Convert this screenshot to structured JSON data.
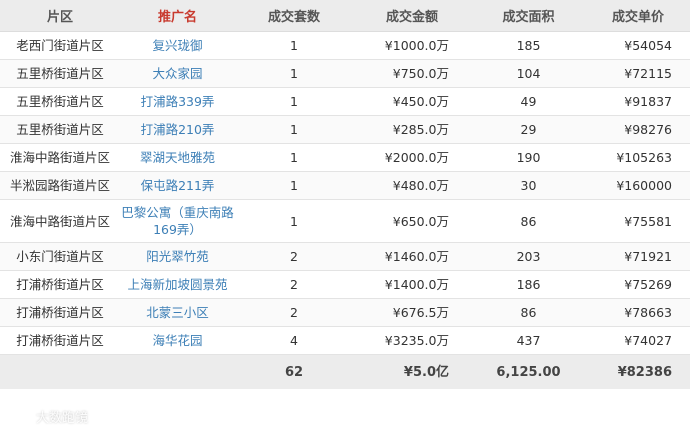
{
  "table": {
    "headers": [
      "片区",
      "推广名",
      "成交套数",
      "成交金额",
      "成交面积",
      "成交单价"
    ],
    "rows": [
      {
        "area": "老西门街道片区",
        "name": "复兴珑御",
        "units": "1",
        "amount": "¥1000.0万",
        "size": "185",
        "price": "¥54054"
      },
      {
        "area": "五里桥街道片区",
        "name": "大众家园",
        "units": "1",
        "amount": "¥750.0万",
        "size": "104",
        "price": "¥72115"
      },
      {
        "area": "五里桥街道片区",
        "name": "打浦路339弄",
        "units": "1",
        "amount": "¥450.0万",
        "size": "49",
        "price": "¥91837"
      },
      {
        "area": "五里桥街道片区",
        "name": "打浦路210弄",
        "units": "1",
        "amount": "¥285.0万",
        "size": "29",
        "price": "¥98276"
      },
      {
        "area": "淮海中路街道片区",
        "name": "翠湖天地雅苑",
        "units": "1",
        "amount": "¥2000.0万",
        "size": "190",
        "price": "¥105263"
      },
      {
        "area": "半淞园路街道片区",
        "name": "保屯路211弄",
        "units": "1",
        "amount": "¥480.0万",
        "size": "30",
        "price": "¥160000"
      },
      {
        "area": "淮海中路街道片区",
        "name": "巴黎公寓（重庆南路169弄）",
        "units": "1",
        "amount": "¥650.0万",
        "size": "86",
        "price": "¥75581"
      },
      {
        "area": "小东门街道片区",
        "name": "阳光翠竹苑",
        "units": "2",
        "amount": "¥1460.0万",
        "size": "203",
        "price": "¥71921"
      },
      {
        "area": "打浦桥街道片区",
        "name": "上海新加坡圆景苑",
        "units": "2",
        "amount": "¥1400.0万",
        "size": "186",
        "price": "¥75269"
      },
      {
        "area": "打浦桥街道片区",
        "name": "北蒙三小区",
        "units": "2",
        "amount": "¥676.5万",
        "size": "86",
        "price": "¥78663"
      },
      {
        "area": "打浦桥街道片区",
        "name": "海华花园",
        "units": "4",
        "amount": "¥3235.0万",
        "size": "437",
        "price": "¥74027"
      }
    ],
    "totals": {
      "units": "62",
      "amount": "¥5.0亿",
      "size": "6,125.00",
      "price": "¥82386"
    }
  },
  "watermark": {
    "text": "大数跑镜",
    "icon": "logo-icon"
  },
  "colors": {
    "header_bg": "#ececec",
    "highlight_header": "#c83a2e",
    "link": "#3d7fb6",
    "footer_bg": "#ececec"
  }
}
